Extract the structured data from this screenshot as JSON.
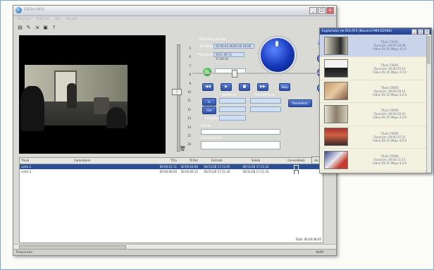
{
  "window": {
    "title": "EditorWin"
  },
  "menu": [
    "Archivo",
    "Edición",
    "Ver",
    "Ayuda"
  ],
  "toolbar": {
    "icons": [
      "open-icon",
      "edit-icon",
      "import-icon",
      "export-icon",
      "help-icon"
    ]
  },
  "panel": {
    "posicion_label": "Posición actual",
    "relativa_label": "Relativa",
    "relativa_value": "00:00:03:06/00:00:18:08",
    "fecha_label": "Fecha/Hora",
    "fecha_value": "2011-06-11 17:04:30",
    "go_label": "GO",
    "relativa2_label": "Relativa",
    "fecha2_label": "Fecha/Hora",
    "in_label": "In",
    "out_label": "Out",
    "longitud_label": "Longitud",
    "titulo_label": "Título",
    "comentario_label": "Comentario",
    "renombrar_label": "Renombrar",
    "transport": [
      "◀◀",
      "▶",
      "■",
      "▶▶"
    ],
    "stop_label": "Stop",
    "slider_ticks": [
      "5",
      "6",
      "7",
      "8",
      "9",
      "10",
      "11",
      "12",
      "13",
      "14",
      "15",
      "16"
    ],
    "slider_value": "7"
  },
  "table": {
    "headers": [
      "Título",
      "Comentario",
      "TCIn",
      "TCOut",
      "Entrada",
      "Salida",
      "Consolidado"
    ],
    "rows": [
      {
        "titulo": "corte 1",
        "comentario": "",
        "tcin": "00:00:01:11",
        "tcout": "00:00:03:00",
        "entrada": "00/11/28 17:11:05",
        "salida": "00/11/28 17:11:22",
        "checked": true
      },
      {
        "titulo": "corte 2",
        "comentario": "",
        "tcin": "00:00:06:00",
        "tcout": "00:00:09:12",
        "entrada": "00/11/28 17:11:30",
        "salida": "00/11/28 17:11:32",
        "checked": false
      }
    ],
    "total_label": "Total: 00:00:08:05"
  },
  "status": {
    "left": "Preparado",
    "right": "NUM"
  },
  "explorer": {
    "title": "Explorador de ID3-AFS (Naceiv3 MM.D2940)",
    "clips": [
      {
        "title": "Título C0001",
        "duration": "Duración: 00:00:18:08",
        "format": "Vídeo DV 25 Mbps 4:2:0"
      },
      {
        "title": "Título C0002",
        "duration": "Duración: 00:00:25:10",
        "format": "Vídeo DV 25 Mbps 4:2:0"
      },
      {
        "title": "Título C0003",
        "duration": "Duración: 00:00:10:14",
        "format": "Vídeo DV 25 Mbps 4:2:0"
      },
      {
        "title": "Título C0004",
        "duration": "Duración: 00:00:20:22",
        "format": "Vídeo DV 25 Mbps 4:2:0"
      },
      {
        "title": "Título C0005",
        "duration": "Duración: 00:00:37:22",
        "format": "Vídeo DV 25 Mbps 4:2:0"
      },
      {
        "title": "Título C0006",
        "duration": "Duración: 00:00:11:15",
        "format": "Vídeo DV 25 Mbps 4:2:0"
      }
    ],
    "cut_label": "De"
  }
}
